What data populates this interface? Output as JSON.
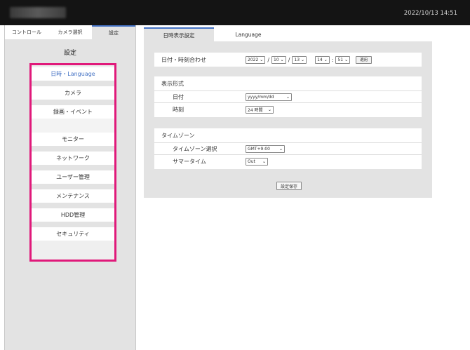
{
  "header": {
    "datetime": "2022/10/13 14:51"
  },
  "left_tabs": [
    {
      "label": "コントロール",
      "active": false
    },
    {
      "label": "カメラ選択",
      "active": false
    },
    {
      "label": "設定",
      "active": true
    }
  ],
  "menu": {
    "title": "設定",
    "items": [
      {
        "label": "日時・Language",
        "active": true
      },
      {
        "label": "カメラ"
      },
      {
        "label": "録画・イベント"
      },
      {
        "label": "モニター"
      },
      {
        "label": "ネットワーク"
      },
      {
        "label": "ユーザー管理"
      },
      {
        "label": "メンテナンス"
      },
      {
        "label": "HDD管理"
      },
      {
        "label": "セキュリティ"
      }
    ]
  },
  "content_tabs": [
    {
      "label": "日時表示設定",
      "active": true
    },
    {
      "label": "Language",
      "active": false
    }
  ],
  "datetime_section": {
    "label": "日付・時刻合わせ",
    "year": "2022",
    "month": "10",
    "day": "13",
    "hour": "14",
    "minute": "51",
    "apply_button": "適用"
  },
  "format_section": {
    "heading": "表示形式",
    "date_label": "日付",
    "date_value": "yyyy/mm/dd",
    "time_label": "時刻",
    "time_value": "24 時間"
  },
  "timezone_section": {
    "heading": "タイムゾーン",
    "zone_label": "タイムゾーン選択",
    "zone_value": "GMT+9:00",
    "dst_label": "サマータイム",
    "dst_value": "Out"
  },
  "save_button": "設定保存",
  "colors": {
    "accent": "#4472c4",
    "highlight_border": "#e0197a",
    "panel_bg": "#e3e3e3",
    "topbar_bg": "#141414"
  }
}
